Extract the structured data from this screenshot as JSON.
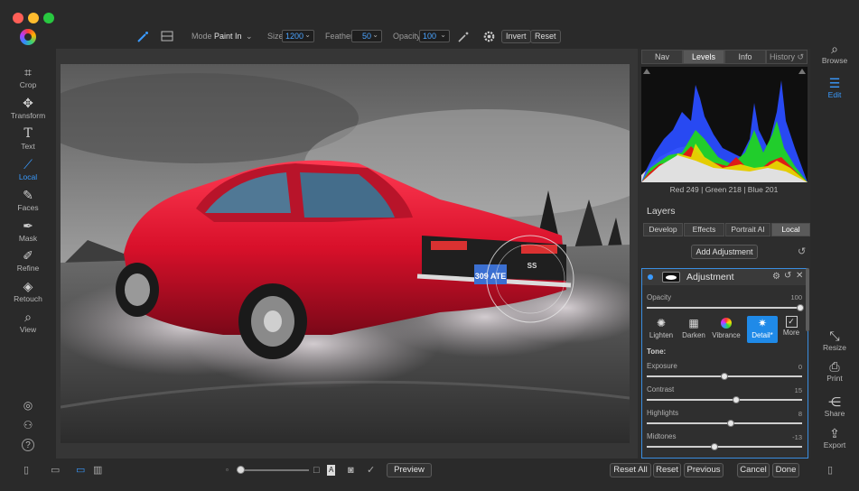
{
  "toolbar": {
    "mode_label": "Mode",
    "mode_value": "Paint In",
    "size_label": "Size",
    "size_value": "1200",
    "feather_label": "Feather",
    "feather_value": "50",
    "opacity_label": "Opacity",
    "opacity_value": "100",
    "invert_label": "Invert",
    "reset_label": "Reset",
    "icons": [
      "local-brush-icon",
      "mask-view-icon",
      "chevron-down-icon",
      "magic-brush-icon",
      "gear-icon"
    ]
  },
  "left_tools": [
    {
      "label": "Crop",
      "icon": "crop-icon"
    },
    {
      "label": "Transform",
      "icon": "transform-icon"
    },
    {
      "label": "Text",
      "icon": "text-icon"
    },
    {
      "label": "Local",
      "icon": "brush-icon",
      "active": true
    },
    {
      "label": "Faces",
      "icon": "faces-icon"
    },
    {
      "label": "Mask",
      "icon": "mask-icon"
    },
    {
      "label": "Refine",
      "icon": "refine-icon"
    },
    {
      "label": "Retouch",
      "icon": "retouch-icon"
    },
    {
      "label": "View",
      "icon": "view-icon"
    }
  ],
  "right_rail": [
    {
      "label": "Browse",
      "icon": "browse-icon"
    },
    {
      "label": "Edit",
      "icon": "edit-icon",
      "active": true
    },
    {
      "label": "Resize",
      "icon": "resize-icon"
    },
    {
      "label": "Print",
      "icon": "print-icon"
    },
    {
      "label": "Share",
      "icon": "share-icon"
    },
    {
      "label": "Export",
      "icon": "export-icon"
    }
  ],
  "panel": {
    "tabs": [
      "Nav",
      "Levels",
      "Info",
      "History"
    ],
    "active_tab": "Levels",
    "histogram_readout": "Red 249 | Green 218 | Blue 201",
    "layers_title": "Layers",
    "layer_tabs": [
      "Develop",
      "Effects",
      "Portrait AI",
      "Local"
    ],
    "active_layer_tab": "Local",
    "add_adjustment_label": "Add Adjustment",
    "adjustment": {
      "title": "Adjustment",
      "opacity_label": "Opacity",
      "opacity_value": "100",
      "presets": [
        {
          "label": "Lighten",
          "icon": "sun-icon"
        },
        {
          "label": "Darken",
          "icon": "darken-icon"
        },
        {
          "label": "Vibrance",
          "icon": "vibrance-icon"
        },
        {
          "label": "Detail*",
          "icon": "detail-icon",
          "active": true
        },
        {
          "label": "More",
          "icon": "more-icon"
        }
      ],
      "tone_label": "Tone:",
      "sliders": [
        {
          "label": "Exposure",
          "value": "0"
        },
        {
          "label": "Contrast",
          "value": "15"
        },
        {
          "label": "Highlights",
          "value": "8"
        },
        {
          "label": "Midtones",
          "value": "-13"
        }
      ]
    }
  },
  "bottom": {
    "preview_label": "Preview",
    "reset_all_label": "Reset All",
    "reset_label": "Reset",
    "previous_label": "Previous",
    "cancel_label": "Cancel",
    "done_label": "Done"
  },
  "photo": {
    "plate_text": "309 ATE",
    "badge_text": "SS"
  },
  "colors": {
    "accent": "#3a9bff",
    "car_red": "#e0142e",
    "background": "#1b1b1b"
  }
}
